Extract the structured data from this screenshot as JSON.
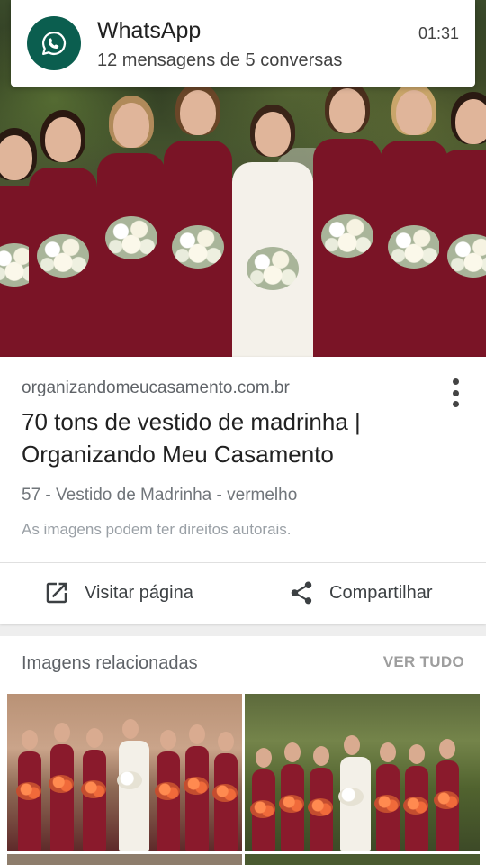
{
  "notification": {
    "app": "WhatsApp",
    "message": "12 mensagens de 5 conversas",
    "time": "01:31",
    "icon": "whatsapp-icon"
  },
  "result": {
    "source": "organizandomeucasamento.com.br",
    "title": "70 tons de vestido de madrinha | Organizando Meu Casamento",
    "subtitle": "57 - Vestido de Madrinha - vermelho",
    "rights": "As imagens podem ter direitos autorais.",
    "actions": {
      "visit": "Visitar página",
      "share": "Compartilhar"
    }
  },
  "related": {
    "title": "Imagens relacionadas",
    "see_all": "VER TUDO"
  },
  "colors": {
    "whatsapp_green": "#0b5e4f",
    "dress": "#7a1426"
  }
}
